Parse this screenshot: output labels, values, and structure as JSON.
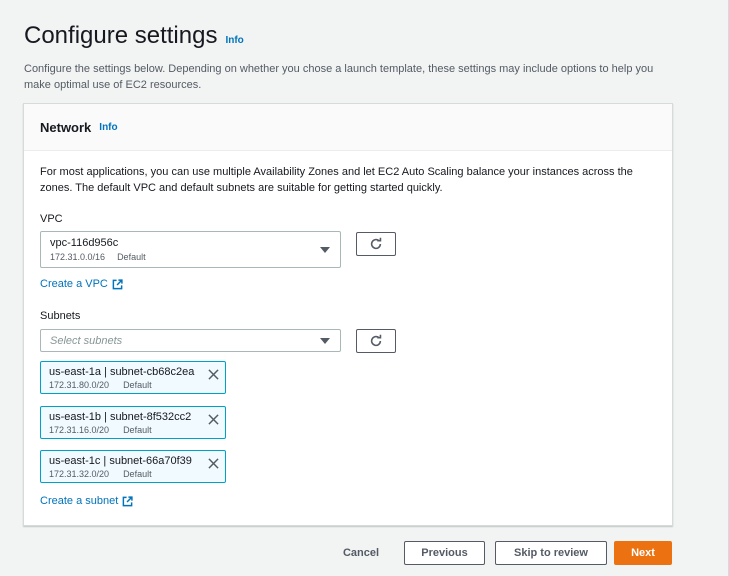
{
  "header": {
    "title": "Configure settings",
    "info_label": "Info",
    "description": "Configure the settings below. Depending on whether you chose a launch template, these settings may include options to help you make optimal use of EC2 resources."
  },
  "network": {
    "title": "Network",
    "info_label": "Info",
    "description": "For most applications, you can use multiple Availability Zones and let EC2 Auto Scaling balance your instances across the zones. The default VPC and default subnets are suitable for getting started quickly.",
    "vpc": {
      "label": "VPC",
      "selected_id": "vpc-116d956c",
      "selected_cidr": "172.31.0.0/16",
      "selected_tag": "Default",
      "create_link": "Create a VPC"
    },
    "subnets": {
      "label": "Subnets",
      "placeholder": "Select subnets",
      "selected": [
        {
          "title": "us-east-1a | subnet-cb68c2ea",
          "cidr": "172.31.80.0/20",
          "tag": "Default"
        },
        {
          "title": "us-east-1b | subnet-8f532cc2",
          "cidr": "172.31.16.0/20",
          "tag": "Default"
        },
        {
          "title": "us-east-1c | subnet-66a70f39",
          "cidr": "172.31.32.0/20",
          "tag": "Default"
        }
      ],
      "create_link": "Create a subnet"
    }
  },
  "footer": {
    "cancel": "Cancel",
    "previous": "Previous",
    "skip": "Skip to review",
    "next": "Next"
  },
  "colors": {
    "background": "#f2f3f3",
    "link": "#0073bb",
    "primary_button": "#ec7211",
    "token_border": "#00a1c9",
    "token_background": "#f1faff"
  },
  "icons": [
    "caret-down-icon",
    "refresh-icon",
    "external-link-icon",
    "close-icon"
  ]
}
